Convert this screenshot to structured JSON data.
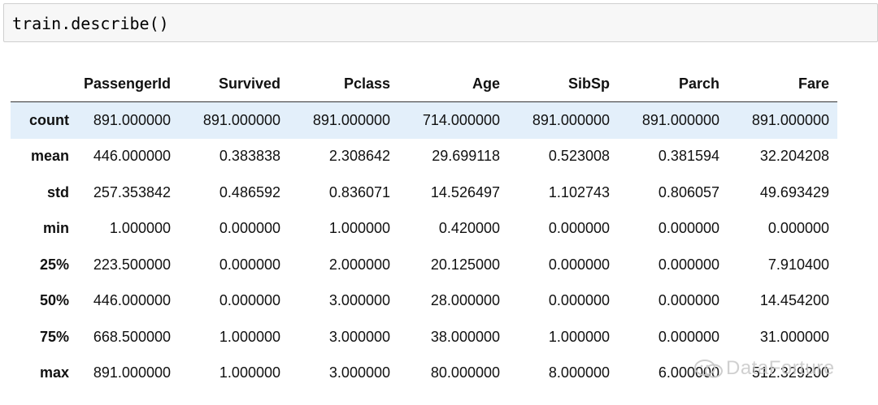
{
  "code_cell": {
    "code": "train.describe()"
  },
  "table": {
    "columns": [
      "PassengerId",
      "Survived",
      "Pclass",
      "Age",
      "SibSp",
      "Parch",
      "Fare"
    ],
    "rows": [
      {
        "label": "count",
        "values": [
          "891.000000",
          "891.000000",
          "891.000000",
          "714.000000",
          "891.000000",
          "891.000000",
          "891.000000"
        ]
      },
      {
        "label": "mean",
        "values": [
          "446.000000",
          "0.383838",
          "2.308642",
          "29.699118",
          "0.523008",
          "0.381594",
          "32.204208"
        ]
      },
      {
        "label": "std",
        "values": [
          "257.353842",
          "0.486592",
          "0.836071",
          "14.526497",
          "1.102743",
          "0.806057",
          "49.693429"
        ]
      },
      {
        "label": "min",
        "values": [
          "1.000000",
          "0.000000",
          "1.000000",
          "0.420000",
          "0.000000",
          "0.000000",
          "0.000000"
        ]
      },
      {
        "label": "25%",
        "values": [
          "223.500000",
          "0.000000",
          "2.000000",
          "20.125000",
          "0.000000",
          "0.000000",
          "7.910400"
        ]
      },
      {
        "label": "50%",
        "values": [
          "446.000000",
          "0.000000",
          "3.000000",
          "28.000000",
          "0.000000",
          "0.000000",
          "14.454200"
        ]
      },
      {
        "label": "75%",
        "values": [
          "668.500000",
          "1.000000",
          "3.000000",
          "38.000000",
          "1.000000",
          "0.000000",
          "31.000000"
        ]
      },
      {
        "label": "max",
        "values": [
          "891.000000",
          "1.000000",
          "3.000000",
          "80.000000",
          "8.000000",
          "6.000000",
          "512.329200"
        ]
      }
    ]
  },
  "watermark": {
    "text": "DataForture",
    "icon": "wechat-icon"
  },
  "colors": {
    "highlight_row": "#e3effa",
    "code_cell_bg": "#f7f7f7"
  }
}
